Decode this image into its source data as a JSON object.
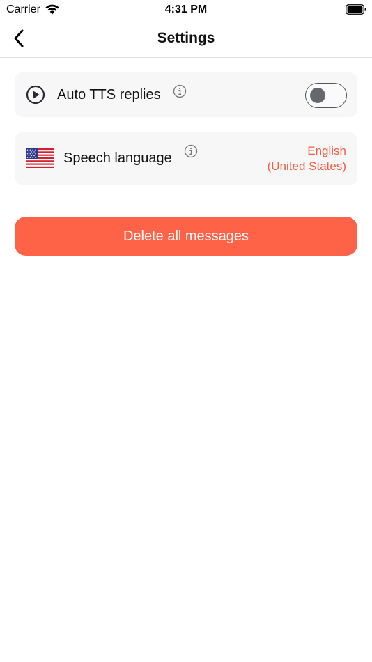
{
  "status_bar": {
    "carrier": "Carrier",
    "time": "4:31 PM",
    "wifi_icon": "wifi-icon",
    "battery_icon": "battery-icon"
  },
  "nav": {
    "title": "Settings",
    "back_icon": "chevron-left-icon"
  },
  "settings": {
    "auto_tts": {
      "label": "Auto TTS replies",
      "icon": "play-circle-icon",
      "info_icon": "info-icon",
      "enabled": false
    },
    "speech_language": {
      "label": "Speech language",
      "icon": "us-flag-icon",
      "info_icon": "info-icon",
      "value_line1": "English",
      "value_line2": "(United States)"
    }
  },
  "actions": {
    "delete_all_label": "Delete all messages"
  },
  "colors": {
    "accent": "#ff6347",
    "accent_text": "#ee6044",
    "card_background": "#f7f7f8",
    "toggle_border": "#55575c"
  }
}
